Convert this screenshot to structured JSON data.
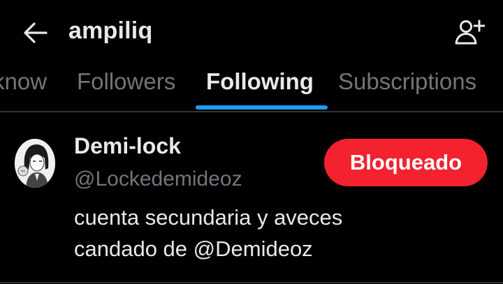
{
  "header": {
    "title": "ampiliq",
    "back_icon": "arrow-left-icon",
    "add_icon": "person-plus-icon"
  },
  "tabs": [
    {
      "label": "know",
      "active": false
    },
    {
      "label": "Followers",
      "active": false
    },
    {
      "label": "Following",
      "active": true
    },
    {
      "label": "Subscriptions",
      "active": false
    }
  ],
  "user": {
    "name": "Demi-lock",
    "handle": "@Lockedemideoz",
    "bio_line1": "cuenta secundaria y aveces",
    "bio_line2": "candado de @Demideoz",
    "button_label": "Bloqueado",
    "avatar_icon": "profile-avatar"
  },
  "colors": {
    "background": "#000000",
    "text_primary": "#e7e9ea",
    "text_secondary": "#71767b",
    "accent": "#1d9bf0",
    "blocked_button": "#f4212e",
    "divider": "#2f3336"
  }
}
